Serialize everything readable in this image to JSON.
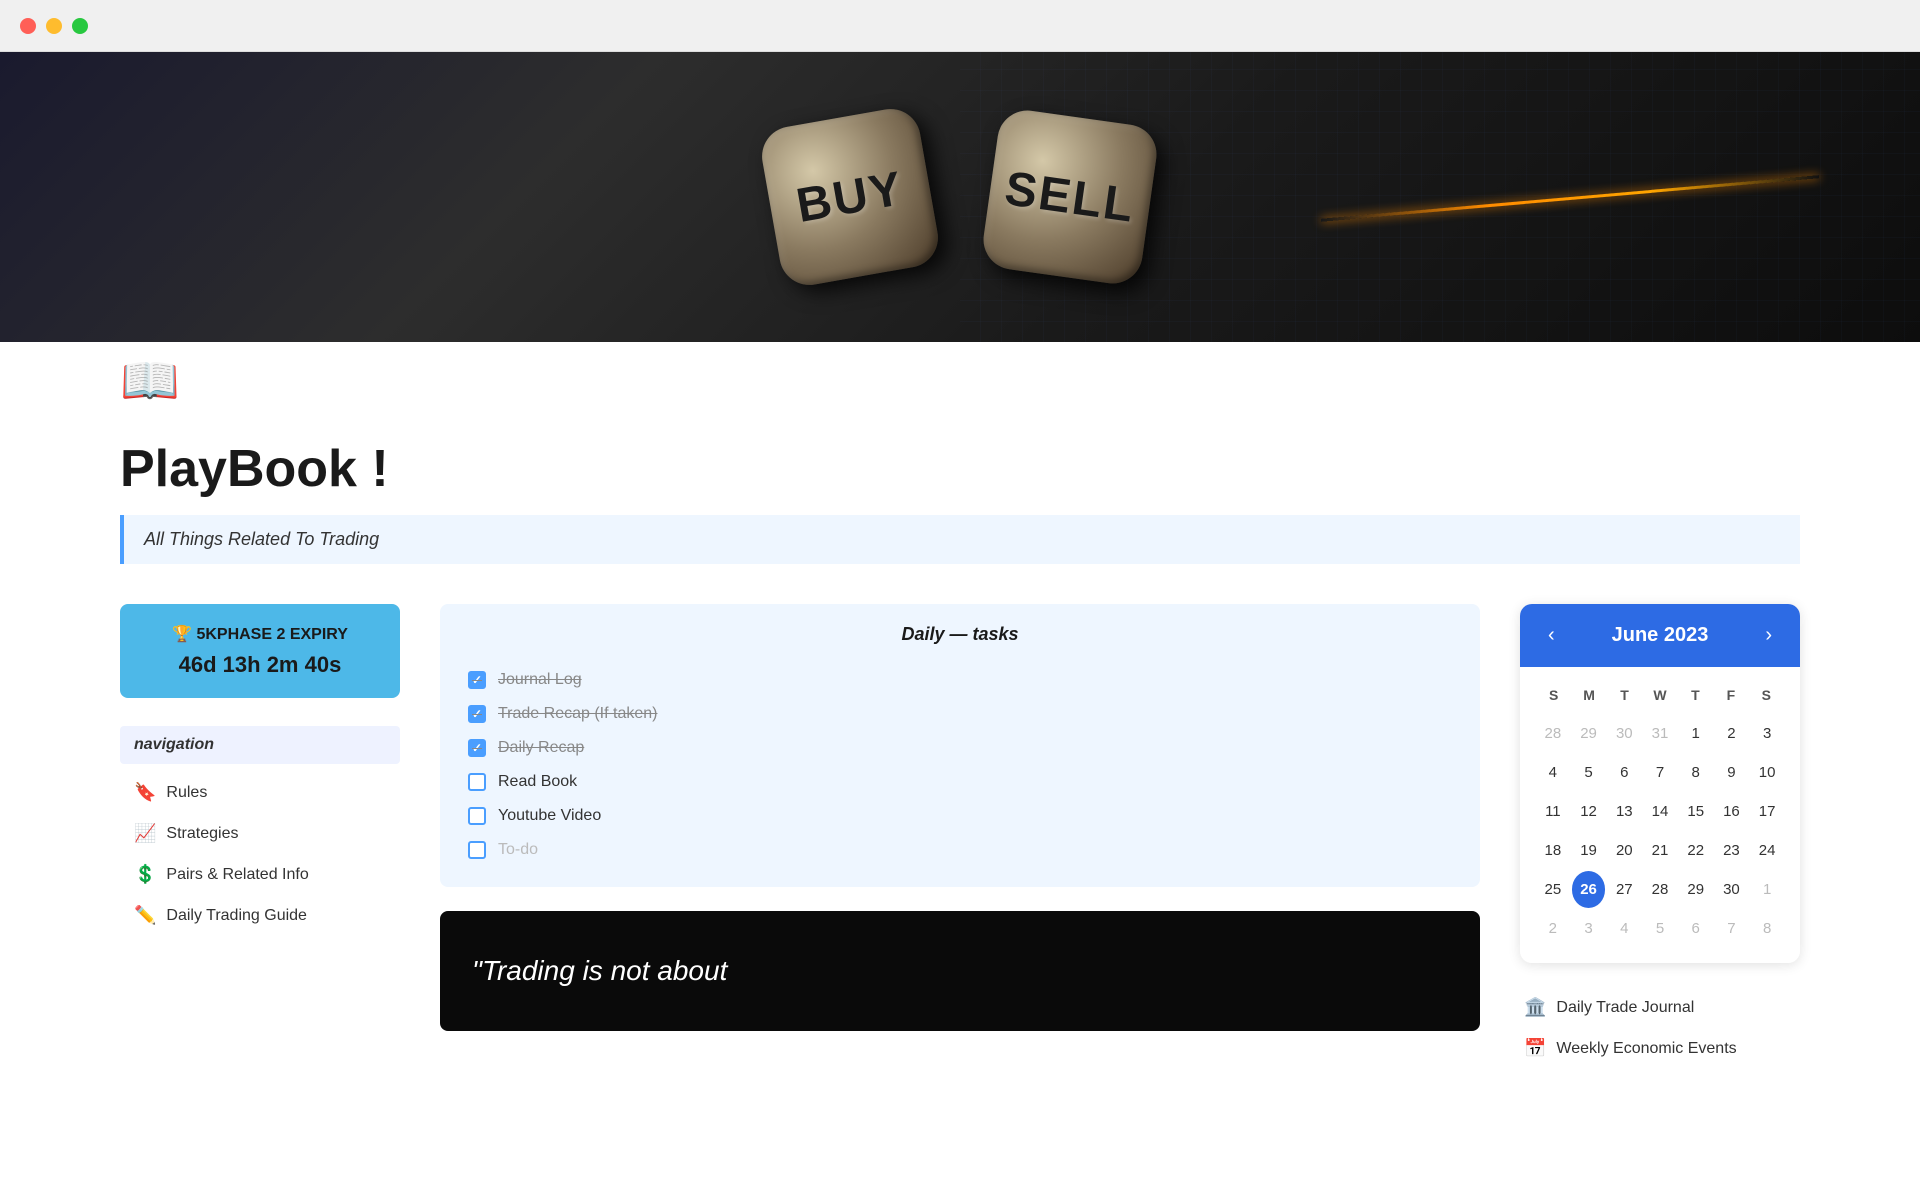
{
  "window": {
    "dots": [
      "red",
      "yellow",
      "green"
    ]
  },
  "hero": {
    "dice_left": "BUY",
    "dice_right": "SELL"
  },
  "book_icon": "📖",
  "page": {
    "title": "PlayBook !",
    "subtitle": "All Things Related To Trading"
  },
  "timer": {
    "label": "🏆 5KPHASE 2 EXPIRY",
    "countdown": "46d 13h 2m 40s"
  },
  "navigation": {
    "header": "navigation",
    "items": [
      {
        "icon": "🔖",
        "label": "Rules"
      },
      {
        "icon": "📈",
        "label": "Strategies"
      },
      {
        "icon": "💲",
        "label": "Pairs & Related Info"
      },
      {
        "icon": "✏️",
        "label": "Daily Trading Guide"
      }
    ]
  },
  "daily_tasks": {
    "title": "Daily — tasks",
    "tasks": [
      {
        "label": "Journal Log",
        "checked": true
      },
      {
        "label": "Trade Recap (If taken)",
        "checked": true
      },
      {
        "label": "Daily Recap",
        "checked": true
      },
      {
        "label": "Read Book",
        "checked": false
      },
      {
        "label": "Youtube Video",
        "checked": false
      },
      {
        "label": "To-do",
        "checked": false,
        "placeholder": true
      }
    ]
  },
  "quote_image": {
    "text": "\"Trading is not about"
  },
  "calendar": {
    "month_year": "June 2023",
    "prev_label": "‹",
    "next_label": "›",
    "days_of_week": [
      "S",
      "M",
      "T",
      "W",
      "T",
      "F",
      "S"
    ],
    "weeks": [
      [
        {
          "day": 28,
          "other": true
        },
        {
          "day": 29,
          "other": true
        },
        {
          "day": 30,
          "other": true
        },
        {
          "day": 31,
          "other": true
        },
        {
          "day": 1,
          "other": false
        },
        {
          "day": 2,
          "other": false
        },
        {
          "day": 3,
          "other": false
        }
      ],
      [
        {
          "day": 4,
          "other": false
        },
        {
          "day": 5,
          "other": false
        },
        {
          "day": 6,
          "other": false
        },
        {
          "day": 7,
          "other": false
        },
        {
          "day": 8,
          "other": false
        },
        {
          "day": 9,
          "other": false
        },
        {
          "day": 10,
          "other": false
        }
      ],
      [
        {
          "day": 11,
          "other": false
        },
        {
          "day": 12,
          "other": false
        },
        {
          "day": 13,
          "other": false
        },
        {
          "day": 14,
          "other": false
        },
        {
          "day": 15,
          "other": false
        },
        {
          "day": 16,
          "other": false
        },
        {
          "day": 17,
          "other": false
        }
      ],
      [
        {
          "day": 18,
          "other": false
        },
        {
          "day": 19,
          "other": false
        },
        {
          "day": 20,
          "other": false
        },
        {
          "day": 21,
          "other": false
        },
        {
          "day": 22,
          "other": false
        },
        {
          "day": 23,
          "other": false
        },
        {
          "day": 24,
          "other": false
        }
      ],
      [
        {
          "day": 25,
          "other": false
        },
        {
          "day": 26,
          "other": false,
          "today": true
        },
        {
          "day": 27,
          "other": false
        },
        {
          "day": 28,
          "other": false
        },
        {
          "day": 29,
          "other": false
        },
        {
          "day": 30,
          "other": false
        },
        {
          "day": 1,
          "other": true
        }
      ],
      [
        {
          "day": 2,
          "other": true
        },
        {
          "day": 3,
          "other": true
        },
        {
          "day": 4,
          "other": true
        },
        {
          "day": 5,
          "other": true
        },
        {
          "day": 6,
          "other": true
        },
        {
          "day": 7,
          "other": true
        },
        {
          "day": 8,
          "other": true
        }
      ]
    ]
  },
  "right_links": [
    {
      "icon": "🏛️",
      "label": "Daily Trade Journal"
    },
    {
      "icon": "📅",
      "label": "Weekly Economic Events"
    }
  ]
}
